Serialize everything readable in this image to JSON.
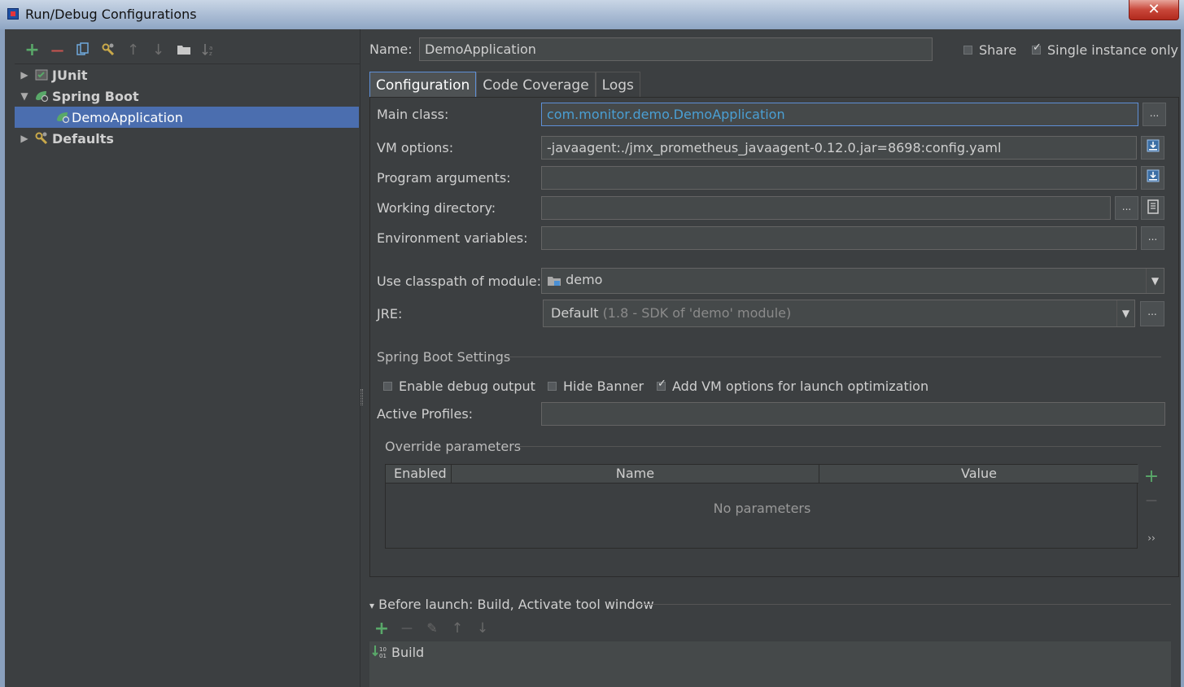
{
  "window": {
    "title": "Run/Debug Configurations",
    "close_glyph": "✕"
  },
  "toolbar": {
    "add": "+",
    "remove": "—",
    "copy": "⧉",
    "edit_defaults": "🔧",
    "move_up": "↑",
    "move_down": "↓",
    "folder": "▬",
    "sort": "↓≡"
  },
  "tree": {
    "items": [
      {
        "label": "JUnit",
        "arrow": "▶"
      },
      {
        "label": "Spring Boot",
        "arrow": "▼"
      },
      {
        "label": "DemoApplication"
      },
      {
        "label": "Defaults",
        "arrow": "▶"
      }
    ]
  },
  "header": {
    "name_label": "Name:",
    "name_value": "DemoApplication",
    "share_label": "Share",
    "share_checked": false,
    "single_instance_label": "Single instance only",
    "single_instance_checked": true
  },
  "tabs": [
    {
      "label": "Configuration",
      "active": true
    },
    {
      "label": "Code Coverage",
      "active": false
    },
    {
      "label": "Logs",
      "active": false
    }
  ],
  "form": {
    "main_class_label": "Main class:",
    "main_class_value": "com.monitor.demo.DemoApplication",
    "vm_options_label": "VM options:",
    "vm_options_value": "-javaagent:./jmx_prometheus_javaagent-0.12.0.jar=8698:config.yaml",
    "program_args_label": "Program arguments:",
    "program_args_value": "",
    "working_dir_label": "Working directory:",
    "working_dir_value": "",
    "env_vars_label": "Environment variables:",
    "env_vars_value": "",
    "classpath_label": "Use classpath of module:",
    "classpath_value": "demo",
    "jre_label": "JRE:",
    "jre_value": "Default",
    "jre_hint": "(1.8 - SDK of 'demo' module)",
    "ellipsis": "...",
    "dropdown_glyph": "▼"
  },
  "spring_boot": {
    "section_title": "Spring Boot Settings",
    "debug_output_label": "Enable debug output",
    "debug_output_checked": false,
    "hide_banner_label": "Hide Banner",
    "hide_banner_checked": false,
    "add_vm_label": "Add VM options for launch optimization",
    "add_vm_checked": true,
    "active_profiles_label": "Active Profiles:",
    "active_profiles_value": ""
  },
  "override": {
    "section_title": "Override parameters",
    "columns": [
      "Enabled",
      "Name",
      "Value"
    ],
    "empty_message": "No parameters",
    "add": "+",
    "remove": "—",
    "more": "››"
  },
  "before_launch": {
    "title": "Before launch: Build, Activate tool window",
    "toggle": "▾",
    "add": "+",
    "remove": "—",
    "edit": "✎",
    "up": "↑",
    "down": "↓",
    "items": [
      "Build"
    ]
  },
  "colors": {
    "background": "#3c3f41",
    "selection": "#4b6eaf",
    "link": "#4a9fd4",
    "add_green": "#59a869",
    "remove_red": "#c75450"
  }
}
